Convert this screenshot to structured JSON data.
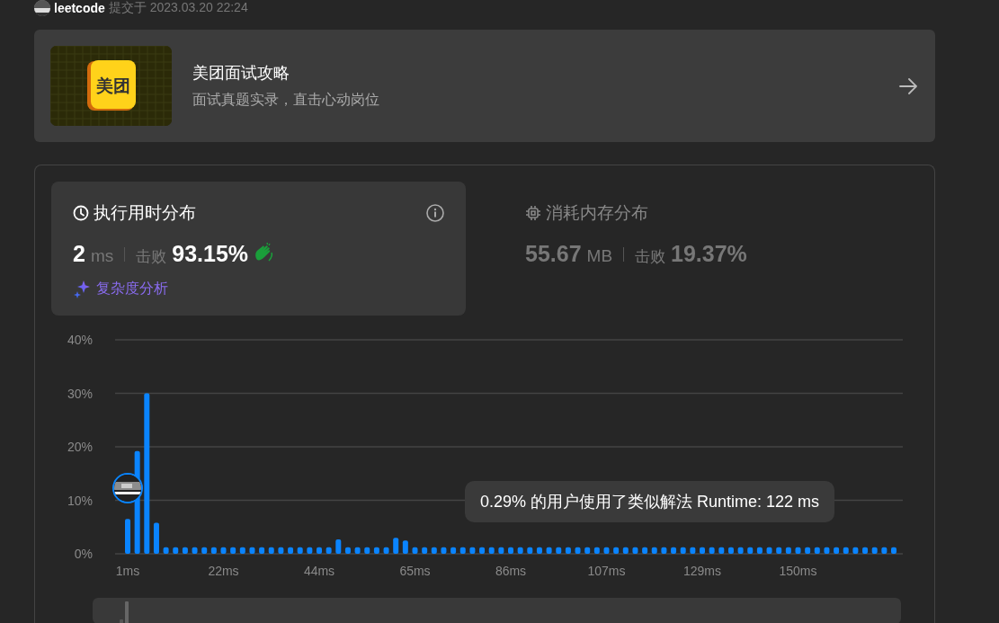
{
  "submission": {
    "author": "leetcode",
    "submitted": "提交于 2023.03.20 22:24"
  },
  "promo": {
    "title": "美团面试攻略",
    "subtitle": "面试真题实录，直击心动岗位",
    "logo_text": "美团"
  },
  "stats": [
    {
      "kind": "runtime",
      "title": "执行用时分布",
      "value": "2",
      "unit": "ms",
      "beats_label": "击败",
      "beats": "93.15%",
      "selected": true,
      "link": "复杂度分析"
    },
    {
      "kind": "memory",
      "title": "消耗内存分布",
      "value": "55.67",
      "unit": "MB",
      "beats_label": "击败",
      "beats": "19.37%",
      "selected": false
    }
  ],
  "chart": {
    "tooltip": "0.29% 的用户使用了类似解法 Runtime: 122 ms",
    "axis_labels": [
      "1ms",
      "22ms",
      "44ms",
      "65ms",
      "86ms",
      "107ms",
      "129ms",
      "150ms"
    ],
    "chart_data": {
      "type": "bar",
      "ylim": [
        0,
        40
      ],
      "grid": true,
      "yticks": [
        {
          "value": 0,
          "label": "0%"
        },
        {
          "value": 10,
          "label": "10%"
        },
        {
          "value": 20,
          "label": "20%"
        },
        {
          "value": 30,
          "label": "30%"
        },
        {
          "value": 40,
          "label": "40%"
        }
      ],
      "series": [
        {
          "color": "#0a84ff",
          "values": [
            6.5,
            19.2,
            30,
            5.8,
            1.2,
            1.2,
            1.2,
            1.2,
            1.2,
            1.2,
            1.2,
            1.2,
            1.2,
            1.2,
            1.2,
            1.2,
            1.2,
            1.2,
            1.2,
            1.2,
            1.2,
            1.2,
            2.7,
            1.2,
            1.2,
            1.2,
            1.2,
            1.2,
            3.0,
            2.5,
            1.2,
            1.2,
            1.2,
            1.2,
            1.2,
            1.2,
            1.2,
            1.2,
            1.2,
            1.2,
            1.2,
            1.2,
            1.2,
            1.2,
            1.2,
            1.2,
            1.2,
            1.2,
            1.2,
            1.2,
            1.2,
            1.2,
            1.2,
            1.2,
            1.2,
            1.2,
            1.2,
            1.2,
            1.2,
            1.2,
            1.2,
            1.2,
            1.2,
            1.2,
            1.2,
            1.2,
            1.2,
            1.2,
            1.2,
            1.2,
            1.2,
            1.2,
            1.2,
            1.2,
            1.2,
            1.2,
            1.2,
            1.2,
            1.2,
            1.2,
            1.2
          ]
        }
      ]
    }
  }
}
